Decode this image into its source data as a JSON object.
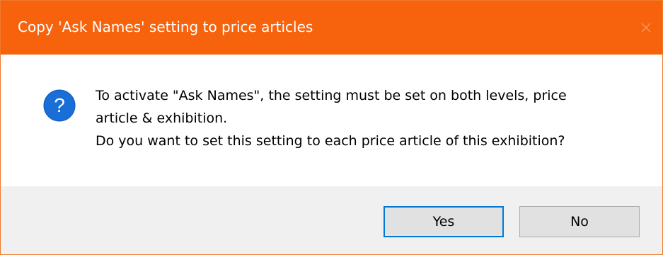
{
  "window": {
    "title": "Copy 'Ask Names' setting to price articles",
    "close_icon": "close-icon",
    "accent_color": "#f7630c"
  },
  "message": {
    "icon": "question-icon",
    "line1": "To activate \"Ask Names\", the setting must be set on both levels, price",
    "line2": "article & exhibition.",
    "line3": "Do you want to set this setting to each price article of this exhibition?"
  },
  "buttons": {
    "yes_label": "Yes",
    "no_label": "No"
  }
}
